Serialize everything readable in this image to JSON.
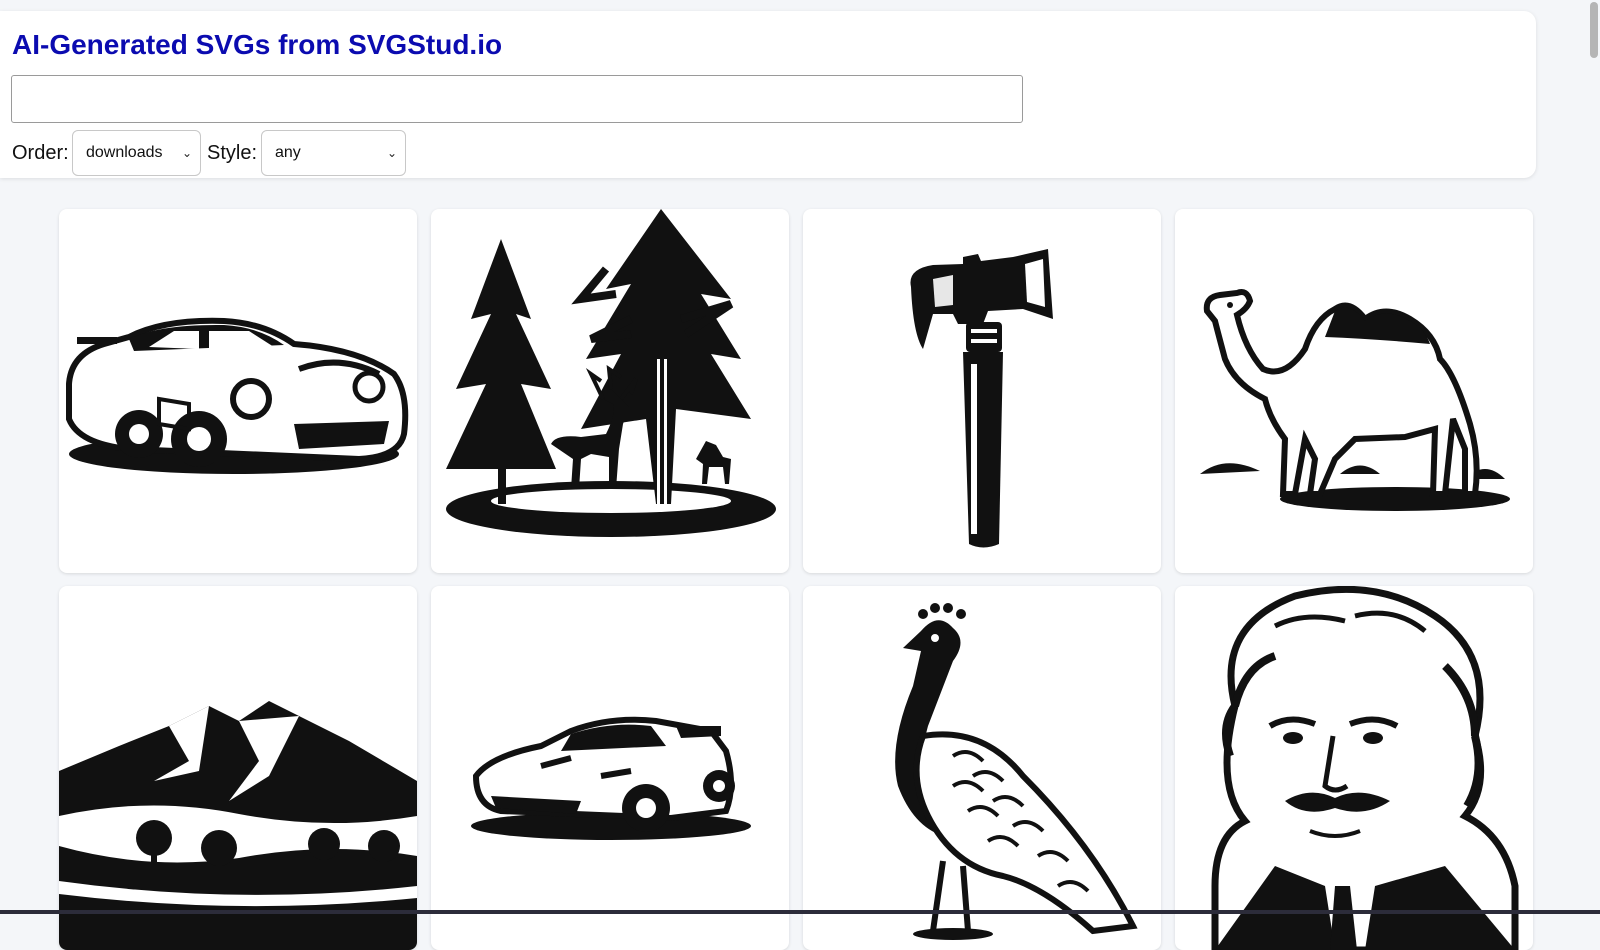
{
  "header": {
    "title": "AI-Generated SVGs from SVGStud.io",
    "search_value": "",
    "order_label": "Order:",
    "order_selected": "downloads",
    "style_label": "Style:",
    "style_selected": "any"
  },
  "gallery": {
    "items": [
      {
        "subject": "sports car"
      },
      {
        "subject": "deer in forest"
      },
      {
        "subject": "hammer"
      },
      {
        "subject": "camel"
      },
      {
        "subject": "mountain landscape"
      },
      {
        "subject": "supercar"
      },
      {
        "subject": "peacock"
      },
      {
        "subject": "einstein portrait"
      }
    ]
  },
  "colors": {
    "title": "#0b0bb0",
    "ink": "#111111",
    "background": "#f4f6f9"
  }
}
